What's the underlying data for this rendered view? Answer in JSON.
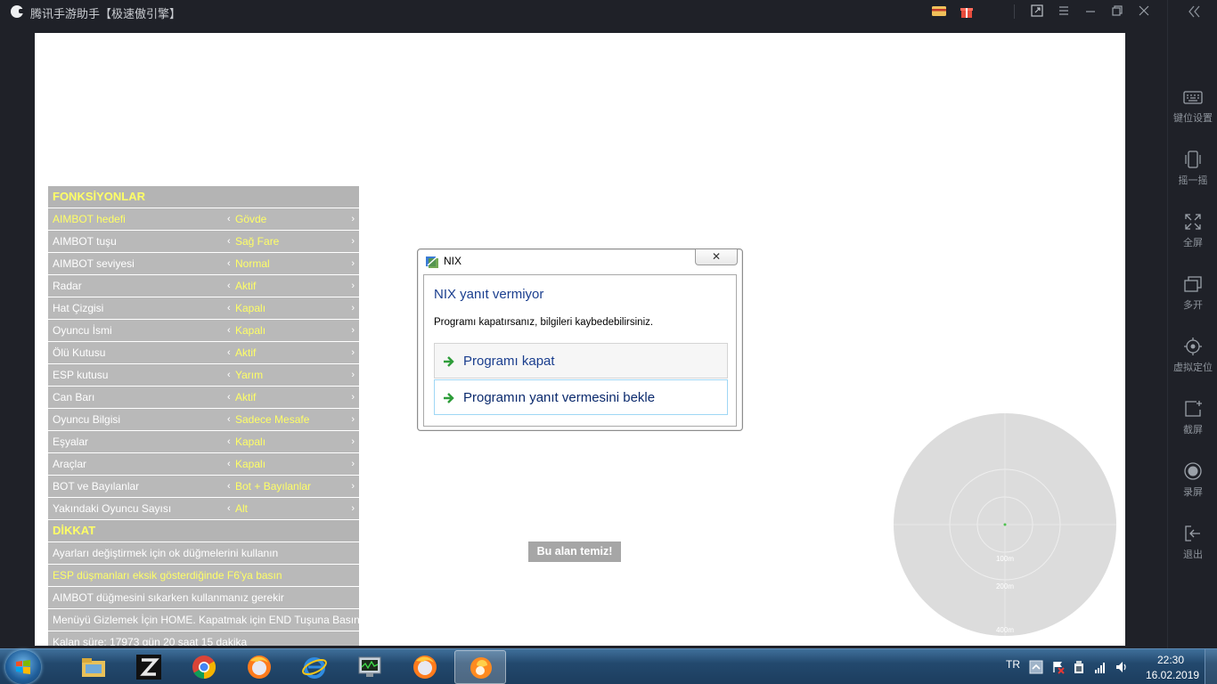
{
  "window": {
    "title": "腾讯手游助手【极速傲引擎】",
    "icons": [
      "card-icon",
      "gift-icon",
      "popout-icon",
      "menu-icon",
      "minimize-icon",
      "restore-icon",
      "close-icon"
    ]
  },
  "sidebar": {
    "collapse_icon": "double-chevron-left-icon",
    "items": [
      {
        "label": "键位设置",
        "icon": "keyboard-icon"
      },
      {
        "label": "摇一摇",
        "icon": "shake-phone-icon"
      },
      {
        "label": "全屏",
        "icon": "fullscreen-icon"
      },
      {
        "label": "多开",
        "icon": "multi-window-icon"
      },
      {
        "label": "虚拟定位",
        "icon": "location-icon"
      },
      {
        "label": "截屏",
        "icon": "screenshot-icon"
      },
      {
        "label": "录屏",
        "icon": "record-icon"
      },
      {
        "label": "退出",
        "icon": "exit-icon"
      }
    ]
  },
  "menu": {
    "functions_header": "FONKSİYONLAR",
    "prev_glyph": "‹",
    "next_glyph": "›",
    "rows": [
      {
        "name": "AIMBOT hedefi",
        "value": "Gövde"
      },
      {
        "name": "AIMBOT tuşu",
        "value": "Sağ Fare"
      },
      {
        "name": "AIMBOT seviyesi",
        "value": "Normal"
      },
      {
        "name": "Radar",
        "value": "Aktif"
      },
      {
        "name": "Hat Çizgisi",
        "value": "Kapalı"
      },
      {
        "name": "Oyuncu İsmi",
        "value": "Kapalı"
      },
      {
        "name": "Ölü Kutusu",
        "value": "Aktif"
      },
      {
        "name": "ESP kutusu",
        "value": "Yarım"
      },
      {
        "name": "Can Barı",
        "value": "Aktif"
      },
      {
        "name": "Oyuncu Bilgisi",
        "value": "Sadece Mesafe"
      },
      {
        "name": "Eşyalar",
        "value": "Kapalı"
      },
      {
        "name": "Araçlar",
        "value": "Kapalı"
      },
      {
        "name": "BOT ve Bayılanlar",
        "value": "Bot + Bayılanlar"
      },
      {
        "name": "Yakındaki Oyuncu Sayısı",
        "value": "Alt"
      }
    ],
    "notice_header": "DİKKAT",
    "notes": [
      "Ayarları değiştirmek için ok düğmelerini kullanın",
      "ESP düşmanları eksik gösterdiğinde F6'ya basın",
      "AIMBOT düğmesini sıkarken kullanmanız gerekir",
      "Menüyü Gizlemek İçin HOME. Kapatmak için END Tuşuna Basın",
      "Kalan süre: 17973 gün 20 saat 15 dakika"
    ]
  },
  "status_tag": "Bu alan temiz!",
  "radar": {
    "rings": [
      "100m",
      "200m",
      "400m"
    ]
  },
  "dialog": {
    "title": "NIX",
    "close_glyph": "✕",
    "heading": "NIX yanıt vermiyor",
    "message": "Programı kapatırsanız, bilgileri kaybedebilirsiniz.",
    "options": [
      {
        "label": "Programı kapat"
      },
      {
        "label": "Programın yanıt vermesini bekle"
      }
    ]
  },
  "taskbar": {
    "apps": [
      {
        "name": "file-explorer-icon"
      },
      {
        "name": "z-app-icon"
      },
      {
        "name": "chrome-icon"
      },
      {
        "name": "firefox-icon"
      },
      {
        "name": "internet-explorer-icon"
      },
      {
        "name": "task-manager-icon"
      },
      {
        "name": "firefox-icon"
      },
      {
        "name": "tencent-gaming-buddy-icon"
      }
    ],
    "language": "TR",
    "time": "22:30",
    "date": "16.02.2019"
  },
  "colors": {
    "menu_bg": "#b9b9b9",
    "menu_highlight": "#ffff66",
    "dialog_link": "#1a3e8e",
    "emulator_bg": "#1f2128"
  }
}
